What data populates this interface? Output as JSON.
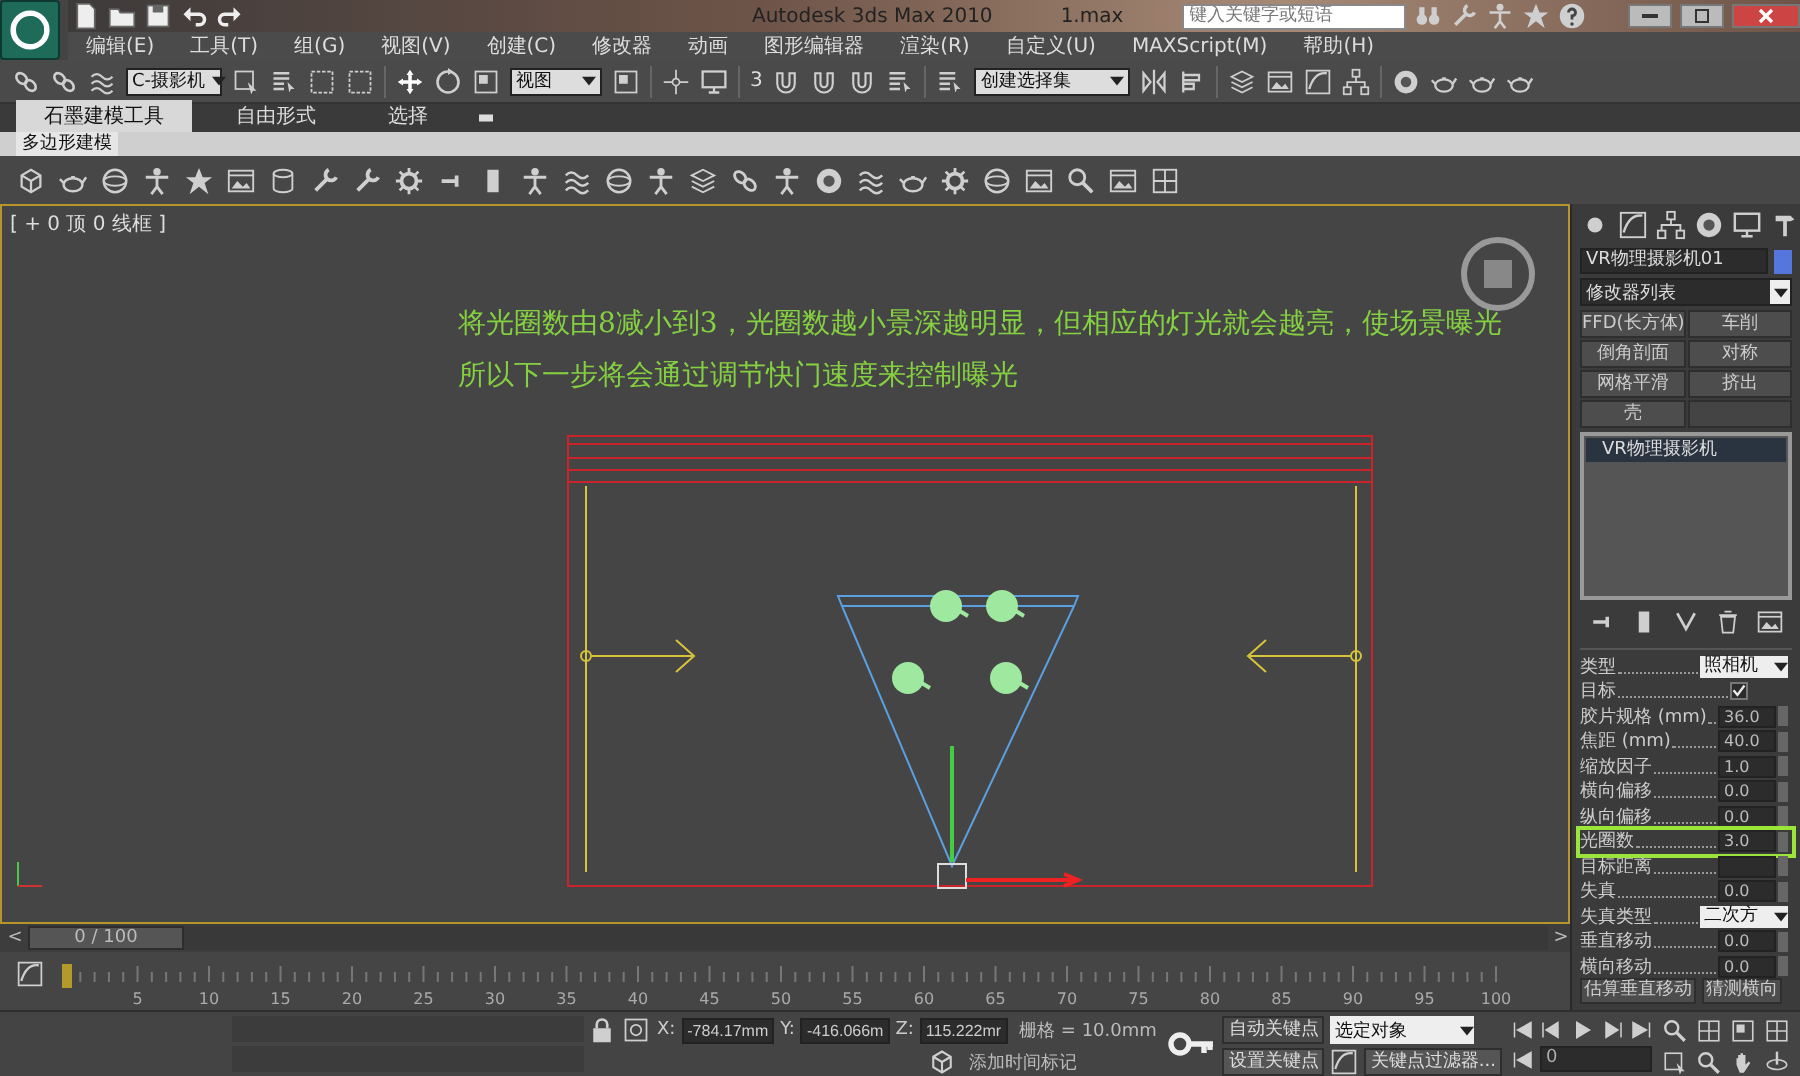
{
  "title_bar": {
    "title": "Autodesk 3ds Max  2010",
    "file": "1.max",
    "search": {
      "placeholder": "键入关键字或短语"
    }
  },
  "menu": [
    "编辑(E)",
    "工具(T)",
    "组(G)",
    "视图(V)",
    "创建(C)",
    "修改器",
    "动画",
    "图形编辑器",
    "渲染(R)",
    "自定义(U)",
    "MAXScript(M)",
    "帮助(H)"
  ],
  "main_toolbar": {
    "selection_filter": "C-摄影机",
    "reference_coord": "视图",
    "snap_label": "3",
    "named_selection": "创建选择集"
  },
  "ribbon": {
    "tabs": [
      {
        "label": "石墨建模工具",
        "selected": true
      },
      {
        "label": "自由形式",
        "selected": false
      },
      {
        "label": "选择",
        "selected": false
      }
    ],
    "panel": "多边形建模"
  },
  "viewport": {
    "label": "[ + 0 顶 0 线框 ]",
    "caption": [
      "将光圈数由8减小到3，光圈数越小景深越明显，但相应的灯光就会越亮，使场景曝光",
      "所以下一步将会通过调节快门速度来控制曝光"
    ]
  },
  "command_panel": {
    "object_name": "VR物理摄影机01",
    "modifier_list": "修改器列表",
    "modifier_buttons": [
      "FFD(长方体)",
      "车削",
      "倒角剖面",
      "对称",
      "网格平滑",
      "挤出",
      "壳"
    ],
    "stack": [
      {
        "label": "VR物理摄影机",
        "selected": true
      }
    ],
    "parameters": [
      {
        "kind": "dropdown",
        "label": "类型",
        "value": "照相机",
        "highlighted": false
      },
      {
        "kind": "checkbox",
        "label": "目标",
        "checked": true,
        "highlighted": false
      },
      {
        "kind": "spinner",
        "label": "胶片规格 (mm)",
        "value": "36.0",
        "highlighted": false
      },
      {
        "kind": "spinner",
        "label": "焦距 (mm)",
        "value": "40.0",
        "highlighted": false
      },
      {
        "kind": "spinner",
        "label": "缩放因子",
        "value": "1.0",
        "highlighted": false
      },
      {
        "kind": "spinner",
        "label": "横向偏移",
        "value": "0.0",
        "highlighted": false
      },
      {
        "kind": "spinner",
        "label": "纵向偏移",
        "value": "0.0",
        "highlighted": false
      },
      {
        "kind": "spinner",
        "label": "光圈数",
        "value": "3.0",
        "highlighted": true
      },
      {
        "kind": "spinner",
        "label": "目标距离",
        "highlighted": false
      },
      {
        "kind": "spinner",
        "label": "失真",
        "value": "0.0",
        "highlighted": false
      },
      {
        "kind": "dropdown",
        "label": "失真类型",
        "value": "二次方",
        "highlighted": false
      },
      {
        "kind": "spinner",
        "label": "垂直移动",
        "value": "0.0",
        "highlighted": false
      },
      {
        "kind": "spinner",
        "label": "横向移动",
        "value": "0.0",
        "highlighted": false
      },
      {
        "kind": "buttons",
        "labels": [
          "估算垂直移动",
          "猜测横向"
        ],
        "highlighted": false
      }
    ]
  },
  "timeline": {
    "prev": "<",
    "slider": "0 / 100",
    "level": 0,
    "next": ">",
    "frames": [
      "5",
      "10",
      "15",
      "20",
      "25",
      "30",
      "35",
      "40",
      "45",
      "50",
      "55",
      "60",
      "65",
      "70",
      "75",
      "80",
      "85",
      "90",
      "95",
      "100"
    ]
  },
  "status_bar": {
    "x_label": "X:",
    "y_label": "Y:",
    "z_label": "Z:",
    "x": "-784.17mm",
    "y": "-416.066m",
    "z": "115.222mr",
    "grid": "栅格 = 10.0mm",
    "add_time_tag": "添加时间标记",
    "auto_key": "自动关键点",
    "key_mode": "选定对象",
    "set_key": "设置关键点",
    "key_filters": "关键点过滤器...",
    "frame": "0"
  }
}
